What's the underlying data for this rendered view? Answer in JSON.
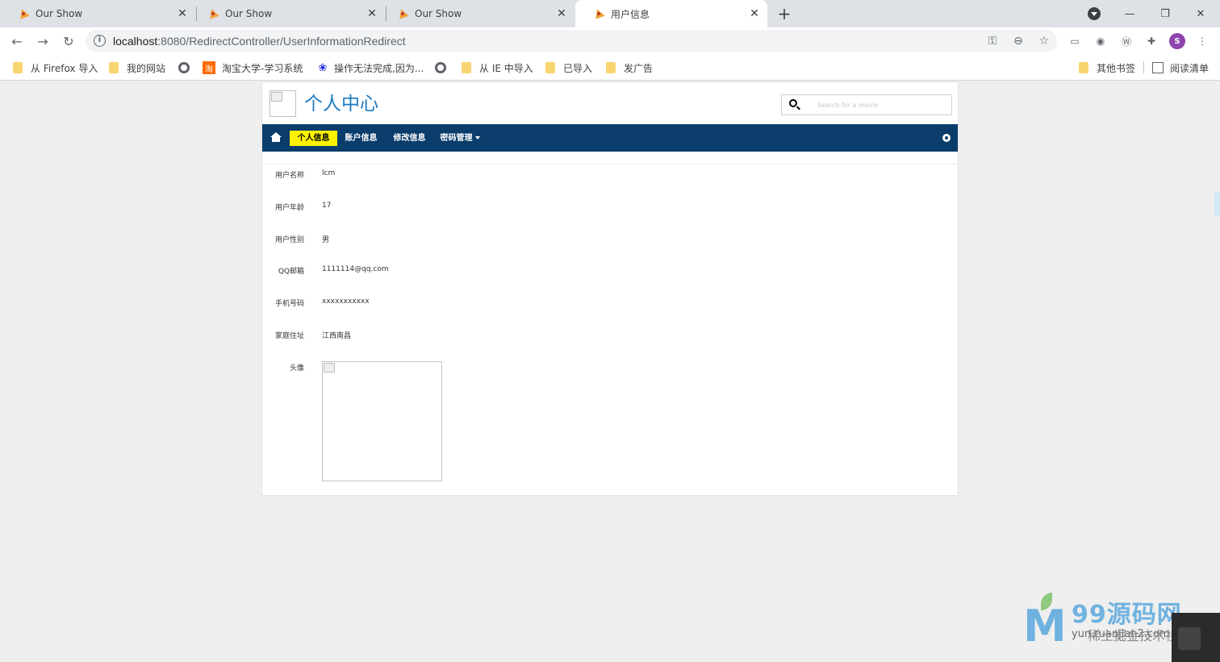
{
  "browser": {
    "tabs": [
      {
        "title": "Our Show",
        "active": false
      },
      {
        "title": "Our Show",
        "active": false
      },
      {
        "title": "Our Show",
        "active": false
      },
      {
        "title": "用户信息",
        "active": true
      }
    ],
    "new_tab": "+",
    "url_host": "localhost",
    "url_path": ":8080/RedirectController/UserInformationRedirect",
    "profile_initial": "S",
    "bookmarks": [
      {
        "label": "从 Firefox 导入",
        "icon": "folder-icon"
      },
      {
        "label": "我的网站",
        "icon": "folder-icon"
      },
      {
        "label": "",
        "icon": "globe-icon"
      },
      {
        "label": "淘宝大学-学习系统",
        "icon": "taobao-icon"
      },
      {
        "label": "操作无法完成,因为...",
        "icon": "baidu-paw-icon"
      },
      {
        "label": "",
        "icon": "globe-icon"
      },
      {
        "label": "从 IE 中导入",
        "icon": "folder-icon"
      },
      {
        "label": "已导入",
        "icon": "folder-icon"
      },
      {
        "label": "发广告",
        "icon": "folder-icon"
      },
      {
        "label": "其他书签",
        "icon": "folder-icon"
      },
      {
        "label": "阅读清单",
        "icon": "reading-list-icon"
      }
    ]
  },
  "site": {
    "title": "个人中心",
    "search_placeholder": "Search for a movie",
    "nav": [
      {
        "label": "个人信息",
        "active": true
      },
      {
        "label": "账户信息",
        "active": false
      },
      {
        "label": "修改信息",
        "active": false
      },
      {
        "label": "密码管理",
        "active": false,
        "dropdown": true
      }
    ]
  },
  "profile": {
    "rows": [
      {
        "label": "用户名称",
        "value": "lcm"
      },
      {
        "label": "用户年龄",
        "value": "17"
      },
      {
        "label": "用户性别",
        "value": "男"
      },
      {
        "label": "QQ邮箱",
        "value": "1111114@qq.com"
      },
      {
        "label": "手机号码",
        "value": "xxxxxxxxxxx"
      },
      {
        "label": "家庭住址",
        "value": "江西南昌"
      }
    ],
    "avatar_label": "头像"
  },
  "watermark": {
    "logo_letter": "M",
    "brand": "99源码网",
    "url": "yun.ruanjian2.com",
    "overlay": "稀土掘金技术社区"
  }
}
